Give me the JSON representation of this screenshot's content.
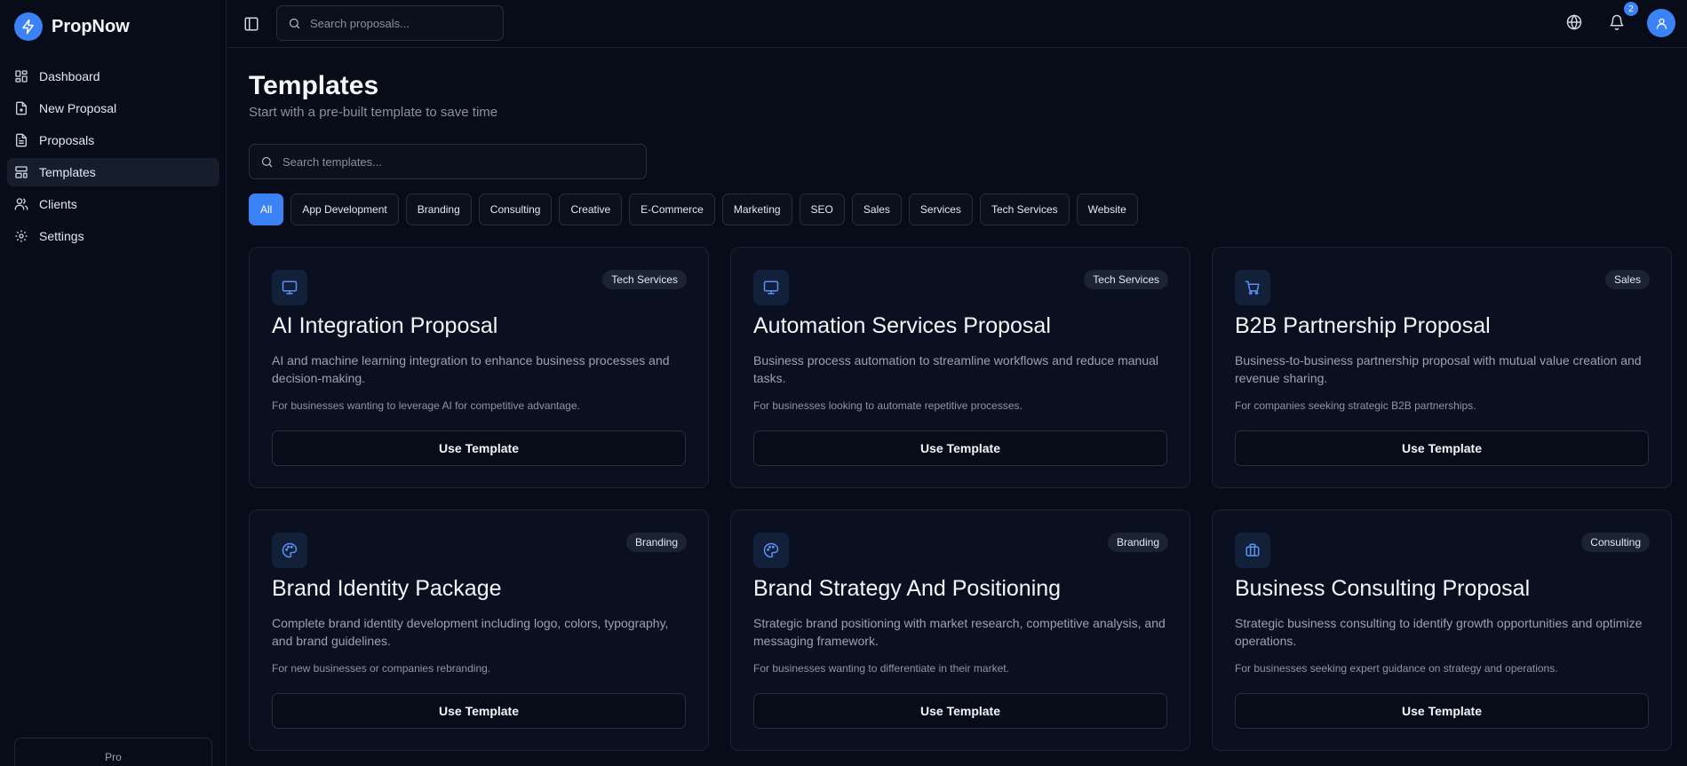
{
  "brand": {
    "name": "PropNow"
  },
  "sidebar": {
    "items": [
      {
        "label": "Dashboard",
        "icon": "dashboard-icon",
        "active": false
      },
      {
        "label": "New Proposal",
        "icon": "file-plus-icon",
        "active": false
      },
      {
        "label": "Proposals",
        "icon": "file-text-icon",
        "active": false
      },
      {
        "label": "Templates",
        "icon": "layout-template-icon",
        "active": true
      },
      {
        "label": "Clients",
        "icon": "users-icon",
        "active": false
      },
      {
        "label": "Settings",
        "icon": "gear-icon",
        "active": false
      }
    ],
    "plan_label": "Pro"
  },
  "topbar": {
    "search_placeholder": "Search proposals...",
    "notification_count": "2"
  },
  "page": {
    "title": "Templates",
    "subtitle": "Start with a pre-built template to save time",
    "search_placeholder": "Search templates..."
  },
  "filters": [
    {
      "label": "All",
      "active": true
    },
    {
      "label": "App Development"
    },
    {
      "label": "Branding"
    },
    {
      "label": "Consulting"
    },
    {
      "label": "Creative"
    },
    {
      "label": "E-Commerce"
    },
    {
      "label": "Marketing"
    },
    {
      "label": "SEO"
    },
    {
      "label": "Sales"
    },
    {
      "label": "Services"
    },
    {
      "label": "Tech Services"
    },
    {
      "label": "Website"
    }
  ],
  "templates": [
    {
      "icon": "monitor-icon",
      "category": "Tech Services",
      "title": "AI Integration Proposal",
      "description": "AI and machine learning integration to enhance business processes and decision-making.",
      "audience": "For businesses wanting to leverage AI for competitive advantage.",
      "button": "Use Template"
    },
    {
      "icon": "monitor-icon",
      "category": "Tech Services",
      "title": "Automation Services Proposal",
      "description": "Business process automation to streamline workflows and reduce manual tasks.",
      "audience": "For businesses looking to automate repetitive processes.",
      "button": "Use Template"
    },
    {
      "icon": "shopping-cart-icon",
      "category": "Sales",
      "title": "B2B Partnership Proposal",
      "description": "Business-to-business partnership proposal with mutual value creation and revenue sharing.",
      "audience": "For companies seeking strategic B2B partnerships.",
      "button": "Use Template"
    },
    {
      "icon": "palette-icon",
      "category": "Branding",
      "title": "Brand Identity Package",
      "description": "Complete brand identity development including logo, colors, typography, and brand guidelines.",
      "audience": "For new businesses or companies rebranding.",
      "button": "Use Template"
    },
    {
      "icon": "palette-icon",
      "category": "Branding",
      "title": "Brand Strategy And Positioning",
      "description": "Strategic brand positioning with market research, competitive analysis, and messaging framework.",
      "audience": "For businesses wanting to differentiate in their market.",
      "button": "Use Template"
    },
    {
      "icon": "briefcase-icon",
      "category": "Consulting",
      "title": "Business Consulting Proposal",
      "description": "Strategic business consulting to identify growth opportunities and optimize operations.",
      "audience": "For businesses seeking expert guidance on strategy and operations.",
      "button": "Use Template"
    }
  ],
  "colors": {
    "accent": "#3b82f6",
    "background": "#080c18",
    "card": "#0b1020",
    "border": "#1c2333"
  }
}
